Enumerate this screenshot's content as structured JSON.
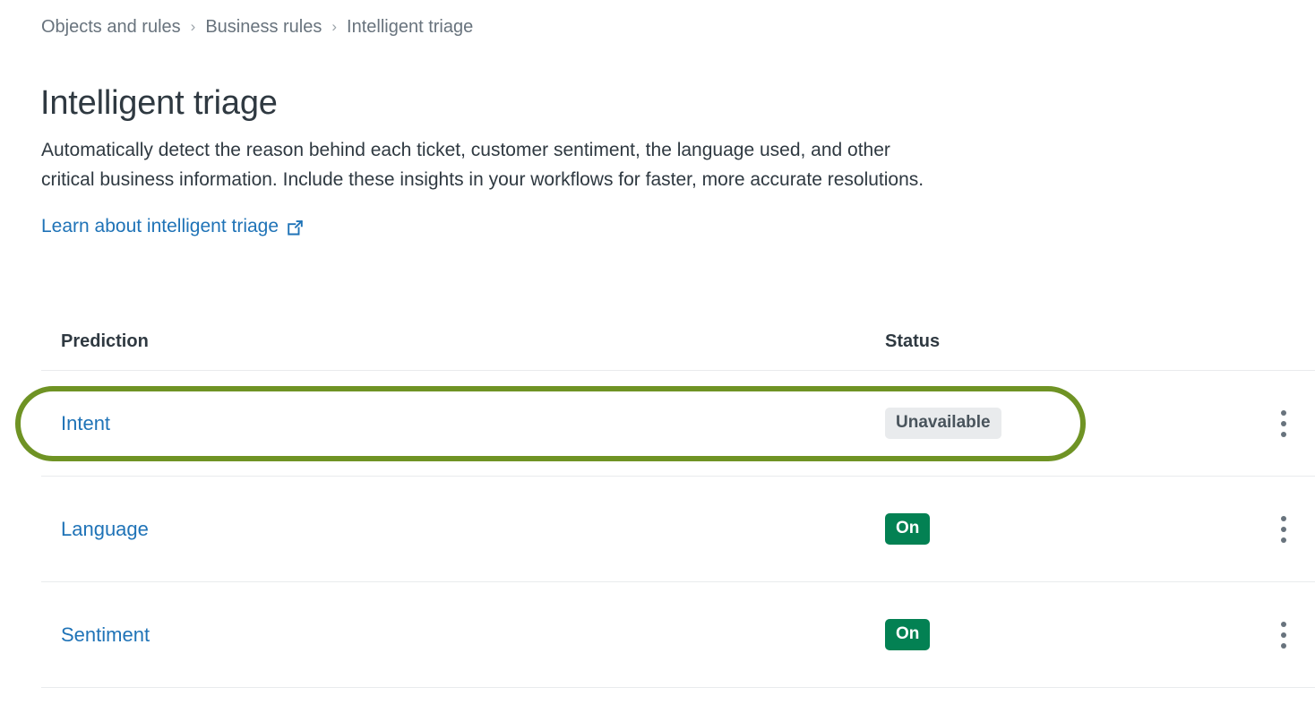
{
  "breadcrumb": {
    "separator": "›",
    "items": [
      {
        "label": "Objects and rules",
        "current": false
      },
      {
        "label": "Business rules",
        "current": false
      },
      {
        "label": "Intelligent triage",
        "current": true
      }
    ]
  },
  "header": {
    "title": "Intelligent triage",
    "description": "Automatically detect the reason behind each ticket, customer sentiment, the language used, and other critical business information. Include these insights in your workflows for faster, more accurate resolutions.",
    "learn_link": {
      "label": "Learn about intelligent triage",
      "icon": "external-link-icon"
    }
  },
  "table": {
    "columns": {
      "prediction": "Prediction",
      "status": "Status"
    },
    "rows": [
      {
        "prediction": "Intent",
        "status": "Unavailable",
        "status_variant": "unavailable",
        "menu_icon": "kebab-menu-icon",
        "highlighted": true
      },
      {
        "prediction": "Language",
        "status": "On",
        "status_variant": "on",
        "menu_icon": "kebab-menu-icon",
        "highlighted": false
      },
      {
        "prediction": "Sentiment",
        "status": "On",
        "status_variant": "on",
        "menu_icon": "kebab-menu-icon",
        "highlighted": false
      }
    ]
  },
  "colors": {
    "link": "#1f73b7",
    "text": "#2f3941",
    "muted": "#68737d",
    "badge_on_bg": "#038153",
    "badge_unavailable_bg": "#e9ebed",
    "annotation_green": "#6f9324",
    "divider": "#e9ebed"
  }
}
